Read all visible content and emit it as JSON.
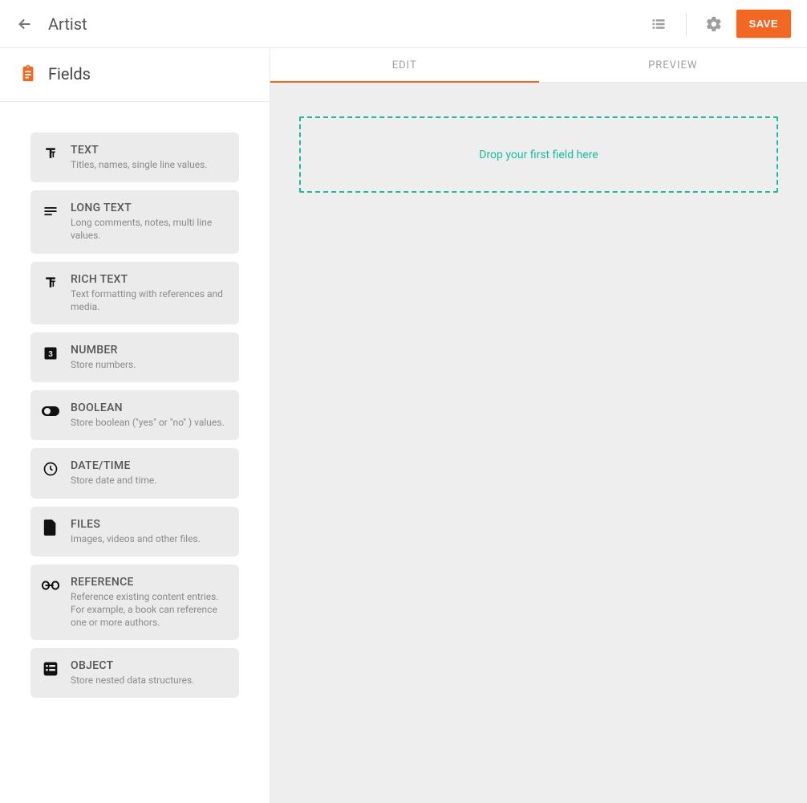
{
  "header": {
    "title": "Artist",
    "save_label": "SAVE"
  },
  "sidebar": {
    "title": "Fields",
    "fields": [
      {
        "icon": "text",
        "name": "TEXT",
        "desc": "Titles, names, single line values."
      },
      {
        "icon": "longtext",
        "name": "LONG TEXT",
        "desc": "Long comments, notes, multi line values."
      },
      {
        "icon": "text",
        "name": "RICH TEXT",
        "desc": "Text formatting with references and media."
      },
      {
        "icon": "number",
        "name": "NUMBER",
        "desc": "Store numbers."
      },
      {
        "icon": "boolean",
        "name": "BOOLEAN",
        "desc": "Store boolean (\"yes\" or \"no\" ) values."
      },
      {
        "icon": "datetime",
        "name": "DATE/TIME",
        "desc": "Store date and time."
      },
      {
        "icon": "files",
        "name": "FILES",
        "desc": "Images, videos and other files."
      },
      {
        "icon": "reference",
        "name": "REFERENCE",
        "desc": "Reference existing content entries. For example, a book can reference one or more authors."
      },
      {
        "icon": "object",
        "name": "OBJECT",
        "desc": "Store nested data structures."
      }
    ]
  },
  "tabs": {
    "edit": "EDIT",
    "preview": "PREVIEW"
  },
  "dropzone": {
    "placeholder": "Drop your first field here"
  }
}
